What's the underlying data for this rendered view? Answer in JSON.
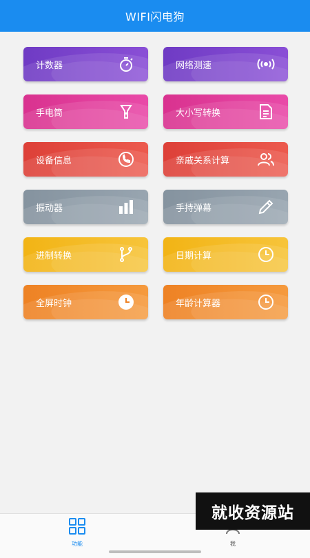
{
  "app": {
    "title": "WIFI闪电狗"
  },
  "tiles": [
    {
      "label": "计数器",
      "icon": "stopwatch-icon",
      "color": "#7b44c9"
    },
    {
      "label": "网络测速",
      "icon": "signal-icon",
      "color": "#7b44c9"
    },
    {
      "label": "手电筒",
      "icon": "flashlight-icon",
      "color": "#e0399a"
    },
    {
      "label": "大小写转换",
      "icon": "document-icon",
      "color": "#e0399a"
    },
    {
      "label": "设备信息",
      "icon": "phone-icon",
      "color": "#e34d43"
    },
    {
      "label": "亲戚关系计算",
      "icon": "people-icon",
      "color": "#e34d43"
    },
    {
      "label": "振动器",
      "icon": "bar-chart-icon",
      "color": "#8d9aa6"
    },
    {
      "label": "手持弹幕",
      "icon": "pencil-icon",
      "color": "#8d9aa6"
    },
    {
      "label": "进制转换",
      "icon": "branch-icon",
      "color": "#f4b81a"
    },
    {
      "label": "日期计算",
      "icon": "clock-icon",
      "color": "#f4b81a"
    },
    {
      "label": "全屏时钟",
      "icon": "clock-filled-icon",
      "color": "#f08b2a"
    },
    {
      "label": "年龄计算器",
      "icon": "clock-icon",
      "color": "#f08b2a"
    }
  ],
  "bottom_nav": {
    "func_label": "功能",
    "me_label": "我"
  },
  "watermark": "就收资源站",
  "colors": {
    "accent": "#1a8cf0"
  }
}
